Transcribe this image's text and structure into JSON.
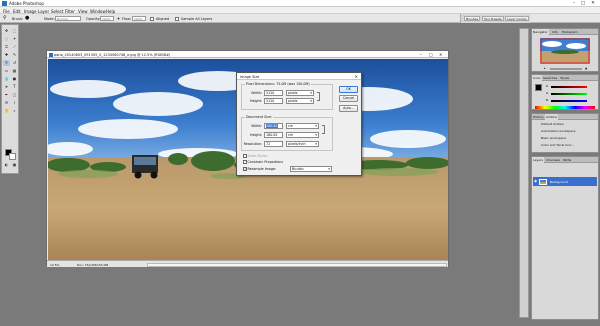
{
  "app": {
    "title": "Adobe Photoshop",
    "window_controls": [
      "–",
      "□",
      "✕"
    ]
  },
  "menu": [
    "File",
    "Edit",
    "Image",
    "Layer",
    "Select",
    "Filter",
    "View",
    "Window",
    "Help"
  ],
  "options": {
    "brush_label": "Brush:",
    "mode_label": "Mode:",
    "mode_value": "Normal",
    "opacity_label": "Opacity:",
    "opacity_value": "100%",
    "flow_label": "Flow:",
    "flow_value": "100%",
    "aligned_label": "Aligned",
    "sample_all_label": "Sample All Layers",
    "wells": [
      "Brushes",
      "Tool Presets",
      "Layer Comps"
    ]
  },
  "document": {
    "title": "pano_20140603_091305_0_1234560748_e.jpg @ 12.5% (RGB/8#)",
    "zoom": "12.5%",
    "doc_size": "Doc: 150.0M/150.0M"
  },
  "image_size": {
    "title": "Image Size",
    "pixel_dimensions_label": "Pixel Dimensions:",
    "pixel_dimensions_value": "75.0M (was 150.0M)",
    "px_width_label": "Width:",
    "px_width_value": "5120",
    "px_width_unit": "pixels",
    "px_height_label": "Height:",
    "px_height_value": "5120",
    "px_height_unit": "pixels",
    "document_size_label": "Document Size:",
    "doc_width_label": "Width:",
    "doc_width_value": "180.62",
    "doc_width_unit": "cm",
    "doc_height_label": "Height:",
    "doc_height_value": "180.62",
    "doc_height_unit": "cm",
    "resolution_label": "Resolution:",
    "resolution_value": "72",
    "resolution_unit": "pixels/inch",
    "scale_styles_label": "Scale Styles",
    "constrain_label": "Constrain Proportions",
    "resample_label": "Resample Image:",
    "resample_value": "Bicubic",
    "ok": "OK",
    "cancel": "Cancel",
    "auto": "Auto..."
  },
  "panels": {
    "navigator": {
      "tabs": [
        "Navigator",
        "Info",
        "Histogram"
      ]
    },
    "color": {
      "tabs": [
        "Color",
        "Swatches",
        "Styles"
      ],
      "channels": [
        "R",
        "G",
        "B"
      ]
    },
    "history": {
      "tabs": [
        "History",
        "Actions"
      ],
      "items": [
        "Default Actions",
        "Automation workspace",
        "Basic workspace",
        "Color and Tonal Corr..."
      ]
    },
    "layers": {
      "tabs": [
        "Layers",
        "Channels",
        "Paths"
      ],
      "layer_name": "Background"
    }
  }
}
